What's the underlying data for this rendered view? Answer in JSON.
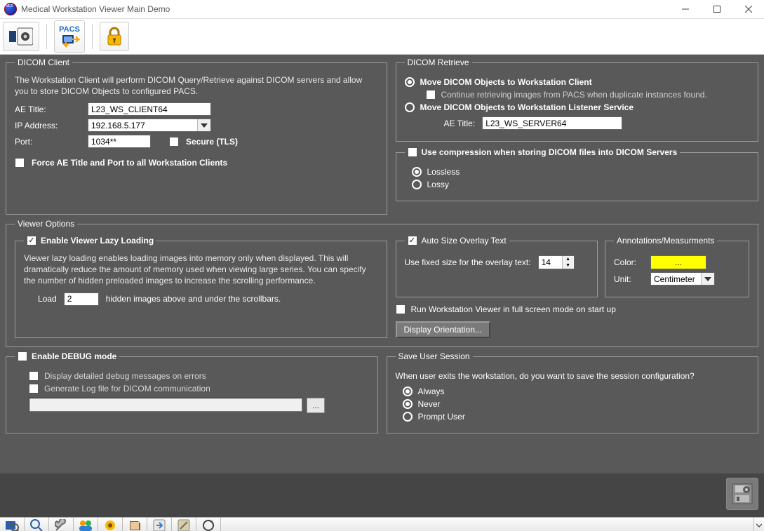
{
  "window": {
    "title": "Medical Workstation Viewer Main Demo"
  },
  "dicom_client": {
    "legend": "DICOM Client",
    "desc": "The Workstation Client will perform DICOM Query/Retrieve against DICOM servers and allow you to store DICOM Objects to configured PACS.",
    "ae_title_label": "AE Title:",
    "ae_title": "L23_WS_CLIENT64",
    "ip_label": "IP Address:",
    "ip": "192.168.5.177",
    "port_label": "Port:",
    "port": "1034**",
    "secure_label": "Secure (TLS)",
    "force_label": "Force AE Title and Port to all Workstation Clients"
  },
  "dicom_retrieve": {
    "legend": "DICOM Retrieve",
    "move_client": "Move DICOM Objects to Workstation Client",
    "continue_label": "Continue retrieving images from PACS when duplicate instances found.",
    "move_listener": "Move DICOM Objects to Workstation Listener Service",
    "ae_title_label": "AE Title:",
    "ae_title": "L23_WS_SERVER64"
  },
  "compression": {
    "legend_prefix": "Use compression when storing DICOM files into DICOM Servers",
    "lossless": "Lossless",
    "lossy": "Lossy"
  },
  "viewer": {
    "legend": "Viewer Options",
    "lazy_legend": "Enable Viewer Lazy Loading",
    "lazy_desc": "Viewer lazy loading enables loading images into memory only when displayed. This will dramatically reduce the amount of memory used when viewing large series. You can specify the number of hidden preloaded images to increase the scrolling performance.",
    "load_label": "Load",
    "load_value": "2",
    "load_suffix": "hidden images above and under the scrollbars.",
    "autosize_legend": "Auto Size Overlay Text",
    "autosize_label": "Use fixed size for the overlay text:",
    "autosize_value": "14",
    "fullscreen_label": "Run Workstation Viewer in full screen mode on start up",
    "display_orientation_btn": "Display Orientation...",
    "annot_legend": "Annotations/Measurments",
    "color_label": "Color:",
    "color_swatch_text": "...",
    "unit_label": "Unit:",
    "unit_value": "Centimeter"
  },
  "debug": {
    "legend": "Enable DEBUG mode",
    "detail_label": "Display detailed debug messages on errors",
    "log_label": "Generate Log file for DICOM communication",
    "browse": "..."
  },
  "session": {
    "legend": "Save User Session",
    "desc": "When user exits the workstation, do you want to save the session configuration?",
    "always": "Always",
    "never": "Never",
    "prompt": "Prompt User"
  },
  "topbar": {
    "pacs_label": "PACS"
  }
}
